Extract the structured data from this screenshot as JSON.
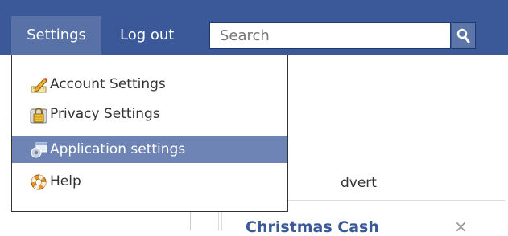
{
  "topbar": {
    "settings_label": "Settings",
    "logout_label": "Log out",
    "search": {
      "placeholder": "Search"
    },
    "brand_color": "#3b5998"
  },
  "menu": {
    "items": [
      {
        "label": "Account Settings",
        "icon": "pencil-ruler-icon"
      },
      {
        "label": "Privacy Settings",
        "icon": "padlock-icon"
      },
      {
        "label": "Application settings",
        "icon": "application-gear-icon",
        "highlighted": true
      },
      {
        "label": "Help",
        "icon": "lifebuoy-icon"
      }
    ],
    "highlight_color": "#6d84b4"
  },
  "background": {
    "advert_fragment": "dvert",
    "ad_title_fragment": "Christmas Cash",
    "close_symbol": "×"
  }
}
